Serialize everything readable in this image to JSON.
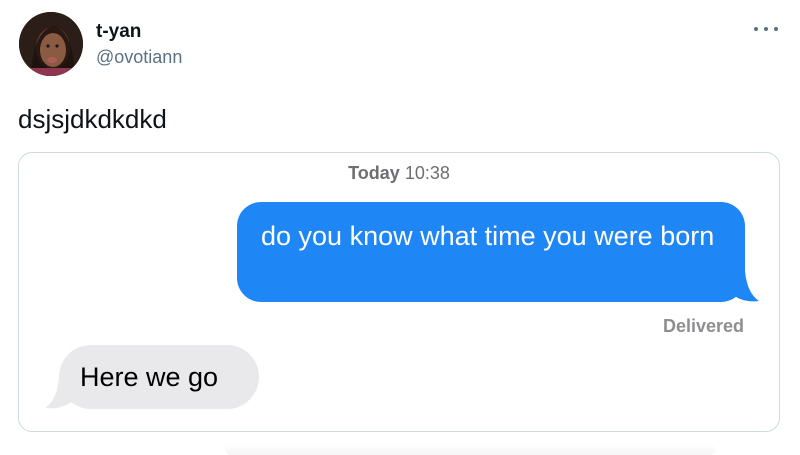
{
  "tweet": {
    "author": {
      "display_name": "t-yan",
      "handle": "@ovotiann",
      "avatar_icon": "profile-photo"
    },
    "more_icon": "more-horizontal-icon",
    "text": "dsjsjdkdkdkd"
  },
  "imessage": {
    "timestamp_day": "Today",
    "timestamp_time": "10:38",
    "outgoing_message": "do you know what time you were born",
    "delivery_status": "Delivered",
    "incoming_message": "Here we go",
    "colors": {
      "outgoing_bubble": "#1f86f5",
      "incoming_bubble": "#e9e9eb"
    }
  }
}
